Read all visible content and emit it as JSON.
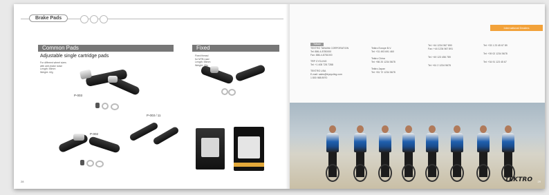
{
  "left_page": {
    "section_tag": "Brake Pads",
    "common_pads": {
      "heading": "Common Pads",
      "subtitle": "Adjustable single cartridge pads",
      "spec": "For different wheel sizes\nwith anti-brake noise\nLength: 55mm\nWeight: 42g"
    },
    "fixed_pads": {
      "heading": "Fixed",
      "spec": "Fixed thread\nfor MTB road\nLength: 55mm\nWeight: 40g"
    },
    "models": [
      "P-003",
      "P-002",
      "P-003 / 11"
    ],
    "page_number": "28"
  },
  "right_page": {
    "banner": "International Dealers",
    "columns": [
      {
        "entries": [
          {
            "label": "Taiwan",
            "lines": [
              "TEKTRO TAIWAN CORPORATION",
              "Tel: 886-4-8780000",
              "Fax: 886-4-8781000"
            ]
          },
          {
            "label": "",
            "lines": [
              "TRP CYCLING",
              "Tel: +1 408 728 7288"
            ]
          },
          {
            "label": "",
            "lines": [
              "TEKTRO USA",
              "E-mail: sales@trpcycling.com",
              "1 800 988 8970"
            ]
          }
        ]
      },
      {
        "entries": [
          {
            "label": "",
            "lines": [
              "Tektro Europe B.V.",
              "Tel: +31 493 691 460"
            ]
          },
          {
            "label": "",
            "lines": [
              "Tektro China",
              "Tel: +86 20 1234 5678"
            ]
          },
          {
            "label": "",
            "lines": [
              "Tektro Japan",
              "Tel: +81 72 1234 5678"
            ]
          }
        ]
      },
      {
        "entries": [
          {
            "label": "",
            "lines": [
              "Tel: +44 1234 567 890",
              "Fax: +44 1234 567 891"
            ]
          },
          {
            "label": "",
            "lines": [
              "Tel: +49 123 456 789"
            ]
          },
          {
            "label": "",
            "lines": [
              "Tel: +61 2 1234 5678"
            ]
          }
        ]
      },
      {
        "entries": [
          {
            "label": "",
            "lines": [
              "Tel: +33 1 23 45 67 89"
            ]
          },
          {
            "label": "",
            "lines": [
              "Tel: +39 02 1234 5678"
            ]
          },
          {
            "label": "",
            "lines": [
              "Tel: +34 91 123 45 67"
            ]
          }
        ]
      }
    ],
    "logo": "TEKTRO",
    "page_number": "29"
  }
}
